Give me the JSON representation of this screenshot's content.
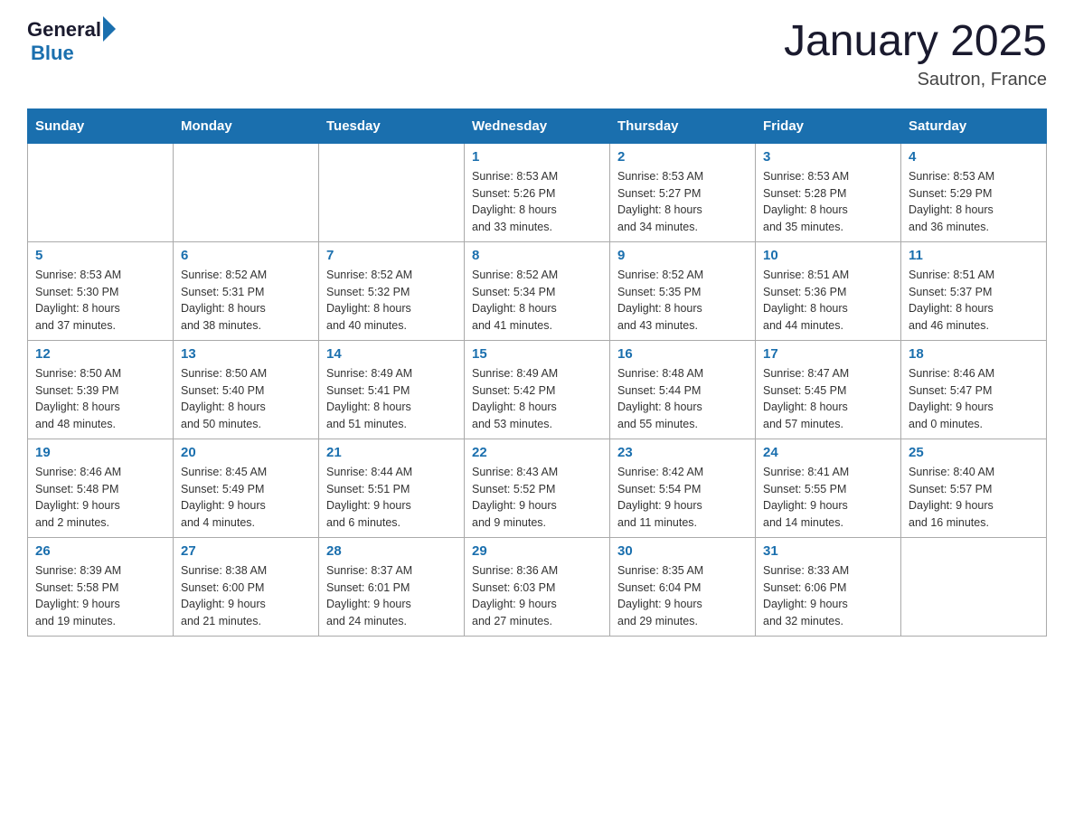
{
  "header": {
    "logo": {
      "general": "General",
      "blue": "Blue"
    },
    "title": "January 2025",
    "subtitle": "Sautron, France"
  },
  "days_of_week": [
    "Sunday",
    "Monday",
    "Tuesday",
    "Wednesday",
    "Thursday",
    "Friday",
    "Saturday"
  ],
  "weeks": [
    [
      {
        "day": "",
        "info": ""
      },
      {
        "day": "",
        "info": ""
      },
      {
        "day": "",
        "info": ""
      },
      {
        "day": "1",
        "info": "Sunrise: 8:53 AM\nSunset: 5:26 PM\nDaylight: 8 hours\nand 33 minutes."
      },
      {
        "day": "2",
        "info": "Sunrise: 8:53 AM\nSunset: 5:27 PM\nDaylight: 8 hours\nand 34 minutes."
      },
      {
        "day": "3",
        "info": "Sunrise: 8:53 AM\nSunset: 5:28 PM\nDaylight: 8 hours\nand 35 minutes."
      },
      {
        "day": "4",
        "info": "Sunrise: 8:53 AM\nSunset: 5:29 PM\nDaylight: 8 hours\nand 36 minutes."
      }
    ],
    [
      {
        "day": "5",
        "info": "Sunrise: 8:53 AM\nSunset: 5:30 PM\nDaylight: 8 hours\nand 37 minutes."
      },
      {
        "day": "6",
        "info": "Sunrise: 8:52 AM\nSunset: 5:31 PM\nDaylight: 8 hours\nand 38 minutes."
      },
      {
        "day": "7",
        "info": "Sunrise: 8:52 AM\nSunset: 5:32 PM\nDaylight: 8 hours\nand 40 minutes."
      },
      {
        "day": "8",
        "info": "Sunrise: 8:52 AM\nSunset: 5:34 PM\nDaylight: 8 hours\nand 41 minutes."
      },
      {
        "day": "9",
        "info": "Sunrise: 8:52 AM\nSunset: 5:35 PM\nDaylight: 8 hours\nand 43 minutes."
      },
      {
        "day": "10",
        "info": "Sunrise: 8:51 AM\nSunset: 5:36 PM\nDaylight: 8 hours\nand 44 minutes."
      },
      {
        "day": "11",
        "info": "Sunrise: 8:51 AM\nSunset: 5:37 PM\nDaylight: 8 hours\nand 46 minutes."
      }
    ],
    [
      {
        "day": "12",
        "info": "Sunrise: 8:50 AM\nSunset: 5:39 PM\nDaylight: 8 hours\nand 48 minutes."
      },
      {
        "day": "13",
        "info": "Sunrise: 8:50 AM\nSunset: 5:40 PM\nDaylight: 8 hours\nand 50 minutes."
      },
      {
        "day": "14",
        "info": "Sunrise: 8:49 AM\nSunset: 5:41 PM\nDaylight: 8 hours\nand 51 minutes."
      },
      {
        "day": "15",
        "info": "Sunrise: 8:49 AM\nSunset: 5:42 PM\nDaylight: 8 hours\nand 53 minutes."
      },
      {
        "day": "16",
        "info": "Sunrise: 8:48 AM\nSunset: 5:44 PM\nDaylight: 8 hours\nand 55 minutes."
      },
      {
        "day": "17",
        "info": "Sunrise: 8:47 AM\nSunset: 5:45 PM\nDaylight: 8 hours\nand 57 minutes."
      },
      {
        "day": "18",
        "info": "Sunrise: 8:46 AM\nSunset: 5:47 PM\nDaylight: 9 hours\nand 0 minutes."
      }
    ],
    [
      {
        "day": "19",
        "info": "Sunrise: 8:46 AM\nSunset: 5:48 PM\nDaylight: 9 hours\nand 2 minutes."
      },
      {
        "day": "20",
        "info": "Sunrise: 8:45 AM\nSunset: 5:49 PM\nDaylight: 9 hours\nand 4 minutes."
      },
      {
        "day": "21",
        "info": "Sunrise: 8:44 AM\nSunset: 5:51 PM\nDaylight: 9 hours\nand 6 minutes."
      },
      {
        "day": "22",
        "info": "Sunrise: 8:43 AM\nSunset: 5:52 PM\nDaylight: 9 hours\nand 9 minutes."
      },
      {
        "day": "23",
        "info": "Sunrise: 8:42 AM\nSunset: 5:54 PM\nDaylight: 9 hours\nand 11 minutes."
      },
      {
        "day": "24",
        "info": "Sunrise: 8:41 AM\nSunset: 5:55 PM\nDaylight: 9 hours\nand 14 minutes."
      },
      {
        "day": "25",
        "info": "Sunrise: 8:40 AM\nSunset: 5:57 PM\nDaylight: 9 hours\nand 16 minutes."
      }
    ],
    [
      {
        "day": "26",
        "info": "Sunrise: 8:39 AM\nSunset: 5:58 PM\nDaylight: 9 hours\nand 19 minutes."
      },
      {
        "day": "27",
        "info": "Sunrise: 8:38 AM\nSunset: 6:00 PM\nDaylight: 9 hours\nand 21 minutes."
      },
      {
        "day": "28",
        "info": "Sunrise: 8:37 AM\nSunset: 6:01 PM\nDaylight: 9 hours\nand 24 minutes."
      },
      {
        "day": "29",
        "info": "Sunrise: 8:36 AM\nSunset: 6:03 PM\nDaylight: 9 hours\nand 27 minutes."
      },
      {
        "day": "30",
        "info": "Sunrise: 8:35 AM\nSunset: 6:04 PM\nDaylight: 9 hours\nand 29 minutes."
      },
      {
        "day": "31",
        "info": "Sunrise: 8:33 AM\nSunset: 6:06 PM\nDaylight: 9 hours\nand 32 minutes."
      },
      {
        "day": "",
        "info": ""
      }
    ]
  ]
}
